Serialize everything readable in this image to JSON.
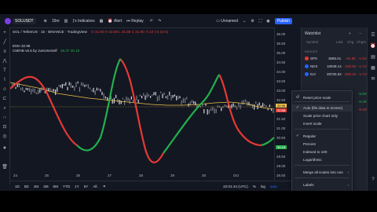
{
  "topbar": {
    "symbol": "SOLUSDT",
    "interval": "15m",
    "indicators_label": "Indicators",
    "alert_label": "Alert",
    "replay_label": "Replay",
    "layout_label": "Unnamed",
    "publish_label": "Publish"
  },
  "legend": {
    "title": "SOL / TetherUS · 15 · BINANCE · TradingView",
    "ohlc": "O 31.90  H 32.08  L 31.88  C 31.90  -0.10 (-0.31%)",
    "ema": "EMA  32.96",
    "indicator": "CM/HB v6.5 by JustUseSelf",
    "indicator_values": "29.37  30.18"
  },
  "price_axis": {
    "labels": [
      "36.00",
      "35.50",
      "35.00",
      "34.50",
      "34.00",
      "33.50",
      "33.00",
      "32.50",
      "32.00",
      "31.50",
      "31.00",
      "30.50",
      "30.00",
      "29.50",
      "29.00",
      "28.50"
    ],
    "badge_price": "32.88",
    "badge_ema": "32.96",
    "badge_green": "30.18"
  },
  "time_axis": {
    "labels": [
      "24",
      "25",
      "26",
      "27",
      "28",
      "29",
      "30",
      "Oct"
    ],
    "clock": "22:01:44 (UTC)",
    "scale_pct": "%",
    "scale_log": "log",
    "scale_auto": "auto"
  },
  "timeframes": [
    "1D",
    "5D",
    "1M",
    "3M",
    "6M",
    "YTD",
    "1Y",
    "5Y",
    "All"
  ],
  "watchlist": {
    "title": "Watchlist",
    "columns": [
      "Symbol",
      "Last",
      "Chg",
      "Chg%"
    ],
    "section": "INDICES",
    "rows": [
      {
        "symbol": "SPX",
        "last": "3585.61",
        "chg": "-54.85",
        "chgp": "-1.51%"
      },
      {
        "symbol": "NDX",
        "last": "10948.14",
        "chg": "-190.94",
        "chgp": "-1.71%"
      },
      {
        "symbol": "DJI",
        "last": "28725.52",
        "chg": "-500.10",
        "chgp": "-1.71%"
      }
    ],
    "partial_values": [
      "-5.80%",
      "-0.28%",
      "-0.43%"
    ]
  },
  "context_menu": {
    "items": [
      {
        "label": "Reset price scale",
        "shortcut": "",
        "checked": false
      },
      {
        "label": "Auto (fits data to screen)",
        "checked": true
      },
      {
        "label": "Scale price chart only",
        "checked": false
      },
      {
        "label": "Invert scale",
        "checked": false
      },
      {
        "label": "Regular",
        "checked": true
      },
      {
        "label": "Percent",
        "checked": false
      },
      {
        "label": "Indexed to 100",
        "checked": false
      },
      {
        "label": "Logarithmic",
        "checked": false
      },
      {
        "label": "Merge all scales into one",
        "checked": false
      },
      {
        "label": "Labels",
        "checked": false
      },
      {
        "label": "Lines",
        "checked": false
      },
      {
        "label": "Countdown to bar close",
        "checked": true
      }
    ]
  },
  "colors": {
    "bg": "#131722",
    "green": "#26a69a",
    "bright_green": "#22b14c",
    "red": "#e53935",
    "yellow": "#f0c14b",
    "price_badge": "#f0c14b"
  },
  "chart_data": {
    "type": "line",
    "ema_value": 32.96,
    "last_price": 32.88,
    "indicator_value": 30.18
  }
}
